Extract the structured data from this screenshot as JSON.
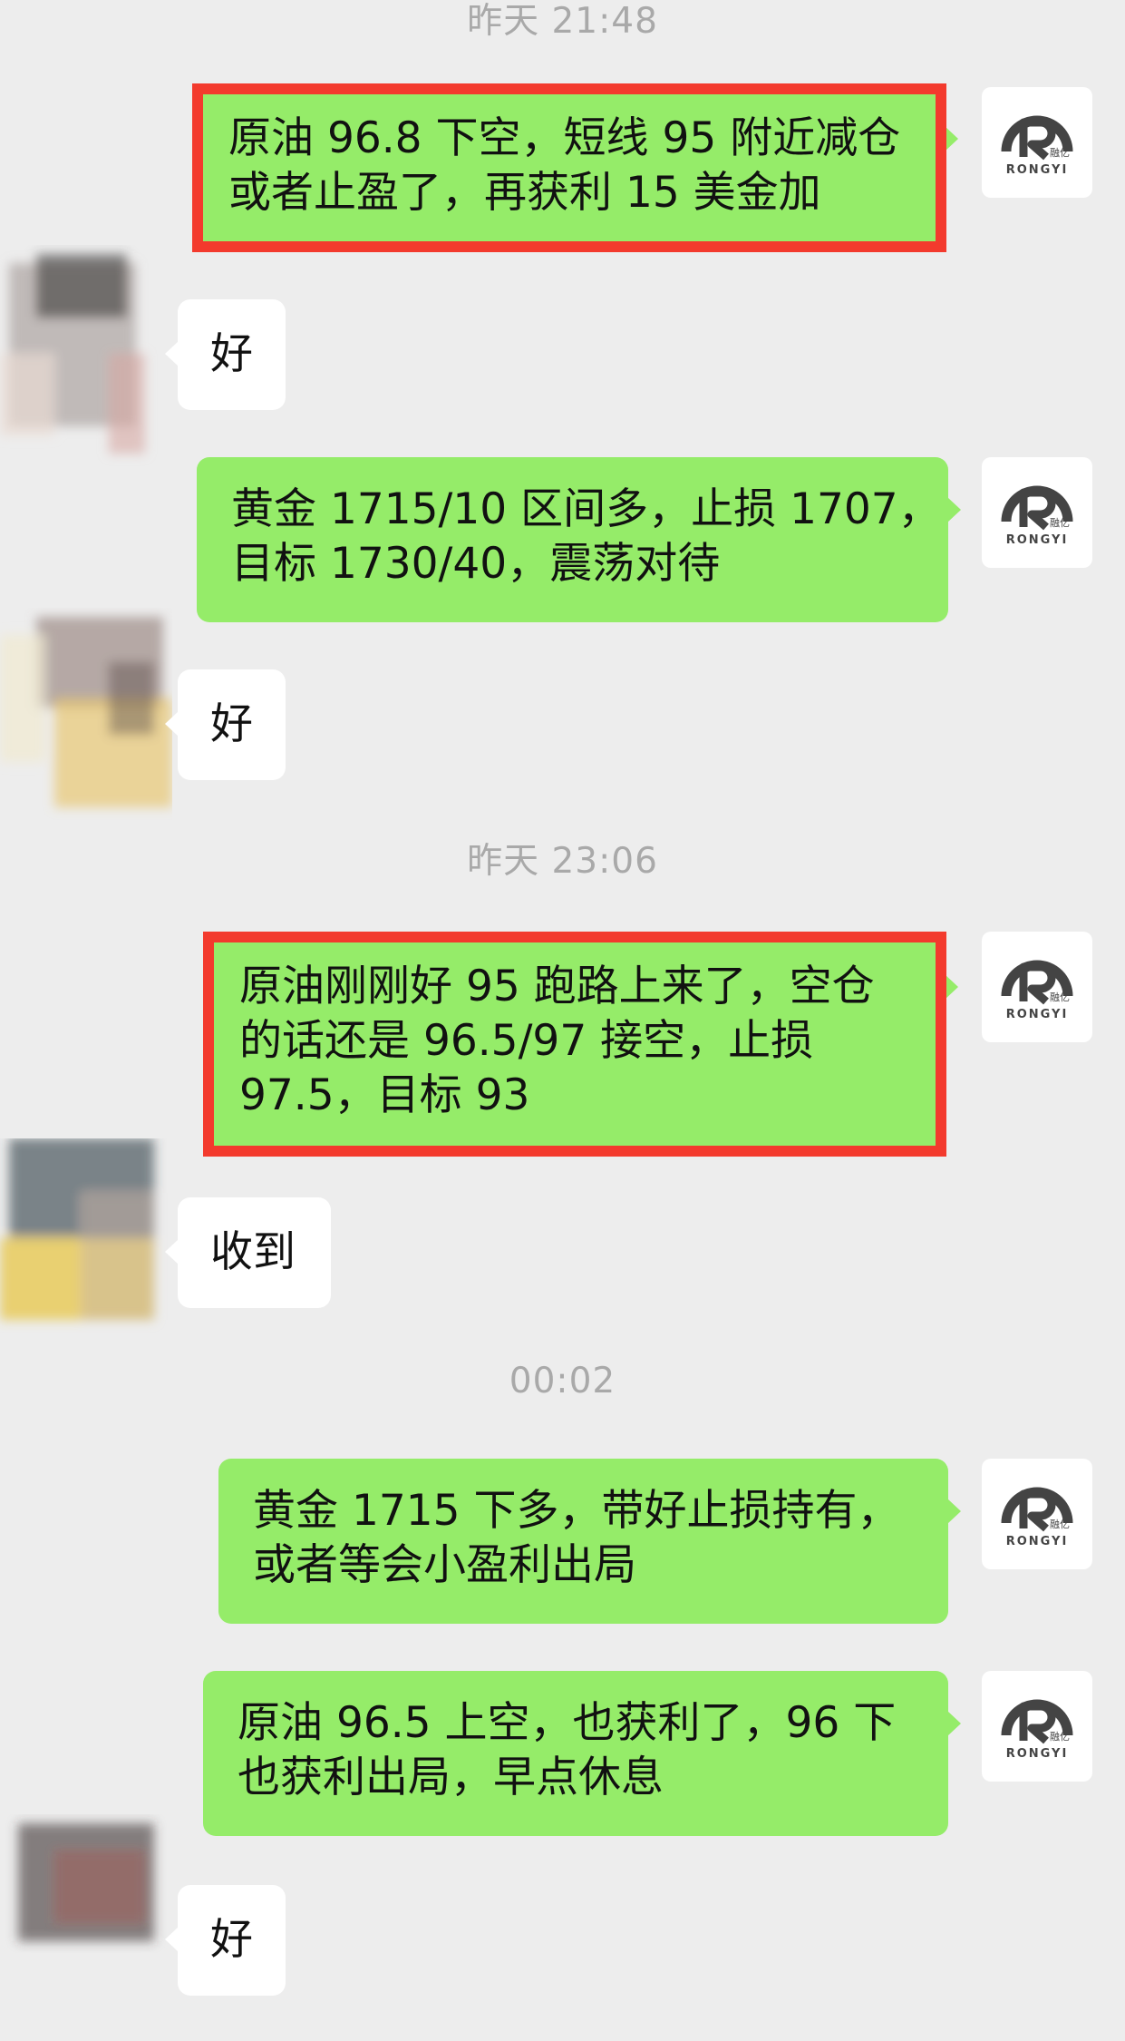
{
  "timestamps": [
    "昨天 21:48",
    "昨天 23:06",
    "00:02"
  ],
  "avatar_logo": {
    "brand": "RONGYI",
    "brand_cn": "融亿",
    "color": "#444444"
  },
  "messages": [
    {
      "side": "right",
      "lines": [
        "原油 96.8 下空，短线 95 附近减仓",
        "或者止盈了，再获利 15 美金加"
      ],
      "highlight": true
    },
    {
      "side": "left",
      "lines": [
        "好"
      ]
    },
    {
      "side": "right",
      "lines": [
        "黄金 1715/10 区间多，止损 1707，",
        "目标 1730/40，震荡对待"
      ],
      "highlight": false
    },
    {
      "side": "left",
      "lines": [
        "好"
      ]
    },
    {
      "side": "right",
      "lines": [
        "原油刚刚好 95 跑路上来了，空仓",
        "的话还是 96.5/97 接空，止损",
        "97.5，目标 93"
      ],
      "highlight": true
    },
    {
      "side": "left",
      "lines": [
        "收到"
      ]
    },
    {
      "side": "right",
      "lines": [
        "黄金 1715 下多，带好止损持有，",
        "或者等会小盈利出局"
      ],
      "highlight": false
    },
    {
      "side": "right",
      "lines": [
        "原油 96.5 上空，也获利了，96 下",
        "也获利出局，早点休息"
      ],
      "highlight": false
    },
    {
      "side": "left",
      "lines": [
        "好"
      ]
    }
  ],
  "colors": {
    "background": "#EDEDED",
    "sent_bubble": "#95EC69",
    "received_bubble": "#FFFFFF",
    "highlight_box": "#F33A2D",
    "timestamp": "#A9A9A9"
  }
}
